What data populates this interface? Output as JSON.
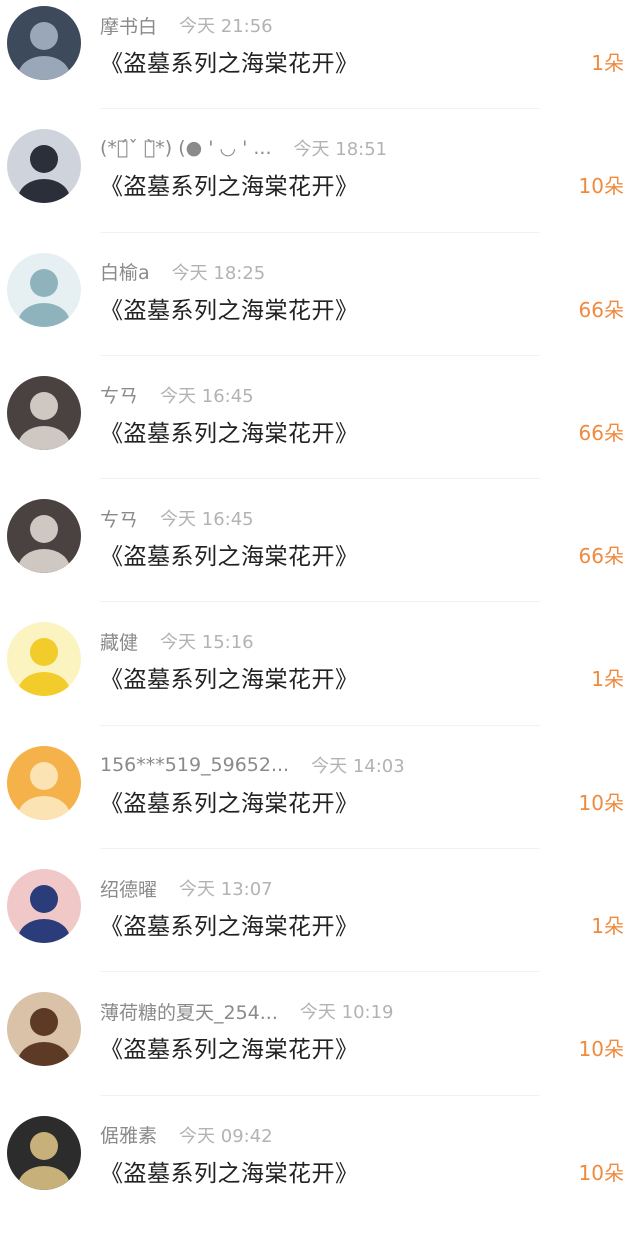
{
  "items": [
    {
      "username": "摩书白",
      "time": "今天 21:56",
      "title": "《盗墓系列之海棠花开》",
      "count": "1朵",
      "avatar": {
        "bg": "#3d4a5c",
        "fg": "#9aa7b8"
      }
    },
    {
      "username": "(*ท́ˇ ท̀*) (● ' ◡ ' ...",
      "time": "今天 18:51",
      "title": "《盗墓系列之海棠花开》",
      "count": "10朵",
      "avatar": {
        "bg": "#cfd3dc",
        "fg": "#2b2f3a"
      }
    },
    {
      "username": "白榆a",
      "time": "今天 18:25",
      "title": "《盗墓系列之海棠花开》",
      "count": "66朵",
      "avatar": {
        "bg": "#e6f0f2",
        "fg": "#8fb3bd"
      }
    },
    {
      "username": "ㄘㄢ",
      "time": "今天 16:45",
      "title": "《盗墓系列之海棠花开》",
      "count": "66朵",
      "avatar": {
        "bg": "#4a4240",
        "fg": "#cfc8c2"
      }
    },
    {
      "username": "ㄘㄢ",
      "time": "今天 16:45",
      "title": "《盗墓系列之海棠花开》",
      "count": "66朵",
      "avatar": {
        "bg": "#4a4240",
        "fg": "#cfc8c2"
      }
    },
    {
      "username": "藏健",
      "time": "今天 15:16",
      "title": "《盗墓系列之海棠花开》",
      "count": "1朵",
      "avatar": {
        "bg": "#fbf3c0",
        "fg": "#f2cc2a"
      }
    },
    {
      "username": "156***519_59652...",
      "time": "今天 14:03",
      "title": "《盗墓系列之海棠花开》",
      "count": "10朵",
      "avatar": {
        "bg": "#f6b24a",
        "fg": "#fbe3b3"
      }
    },
    {
      "username": "绍德曜",
      "time": "今天 13:07",
      "title": "《盗墓系列之海棠花开》",
      "count": "1朵",
      "avatar": {
        "bg": "#f0c8c8",
        "fg": "#2a3c7a"
      }
    },
    {
      "username": "薄荷糖的夏天_254...",
      "time": "今天 10:19",
      "title": "《盗墓系列之海棠花开》",
      "count": "10朵",
      "avatar": {
        "bg": "#d9c2a8",
        "fg": "#5c3a26"
      }
    },
    {
      "username": "倨雅素",
      "time": "今天 09:42",
      "title": "《盗墓系列之海棠花开》",
      "count": "10朵",
      "avatar": {
        "bg": "#2c2c2c",
        "fg": "#c8b07a"
      }
    }
  ]
}
